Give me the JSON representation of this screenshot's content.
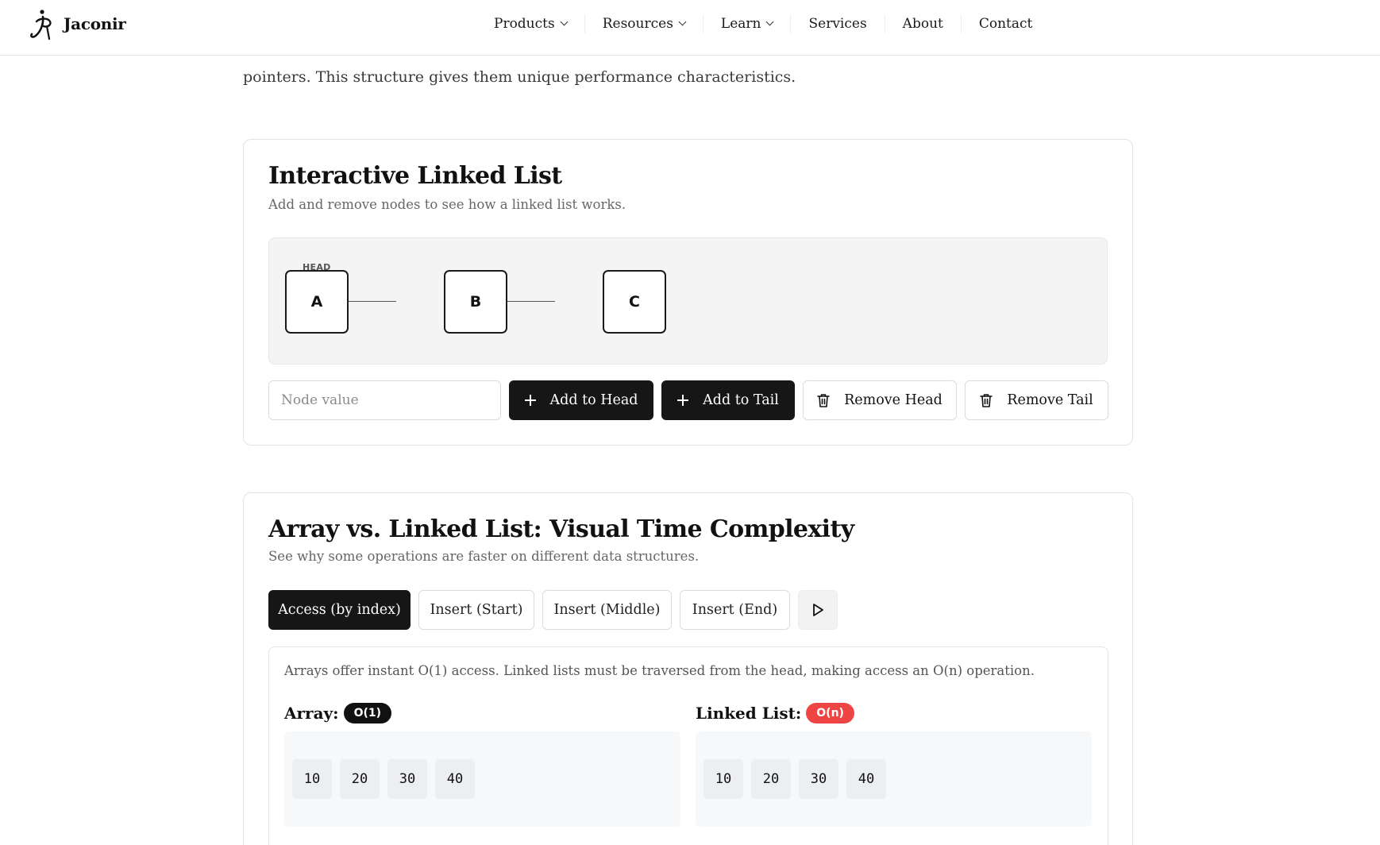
{
  "header": {
    "brand": "Jaconir",
    "nav": [
      {
        "label": "Products",
        "dropdown": true
      },
      {
        "label": "Resources",
        "dropdown": true
      },
      {
        "label": "Learn",
        "dropdown": true
      },
      {
        "label": "Services",
        "dropdown": false
      },
      {
        "label": "About",
        "dropdown": false
      },
      {
        "label": "Contact",
        "dropdown": false
      }
    ]
  },
  "intro": {
    "line_visible": "pointers. This structure gives them unique performance characteristics."
  },
  "linked_list_demo": {
    "title": "Interactive Linked List",
    "subtitle": "Add and remove nodes to see how a linked list works.",
    "head_label": "HEAD",
    "nodes": [
      "A",
      "B",
      "C"
    ],
    "input_placeholder": "Node value",
    "buttons": {
      "add_head": "Add to Head",
      "add_tail": "Add to Tail",
      "remove_head": "Remove Head",
      "remove_tail": "Remove Tail"
    }
  },
  "complexity_demo": {
    "title": "Array vs. Linked List: Visual Time Complexity",
    "subtitle": "See why some operations are faster on different data structures.",
    "tabs": [
      "Access (by index)",
      "Insert (Start)",
      "Insert (Middle)",
      "Insert (End)"
    ],
    "active_tab": "Access (by index)",
    "play_icon": "play-icon",
    "description": "Arrays offer instant O(1) access. Linked lists must be traversed from the head, making access an O(n) operation.",
    "structures": [
      {
        "name": "Array:",
        "complexity": "O(1)",
        "badge_color": "#111111",
        "values": [
          "10",
          "20",
          "30",
          "40"
        ]
      },
      {
        "name": "Linked List:",
        "complexity": "O(n)",
        "badge_color": "#ef4444",
        "values": [
          "10",
          "20",
          "30",
          "40"
        ]
      }
    ]
  },
  "colors": {
    "primary_dark": "#161616",
    "danger": "#ef4444",
    "canvas_bg": "#f4f4f4"
  }
}
